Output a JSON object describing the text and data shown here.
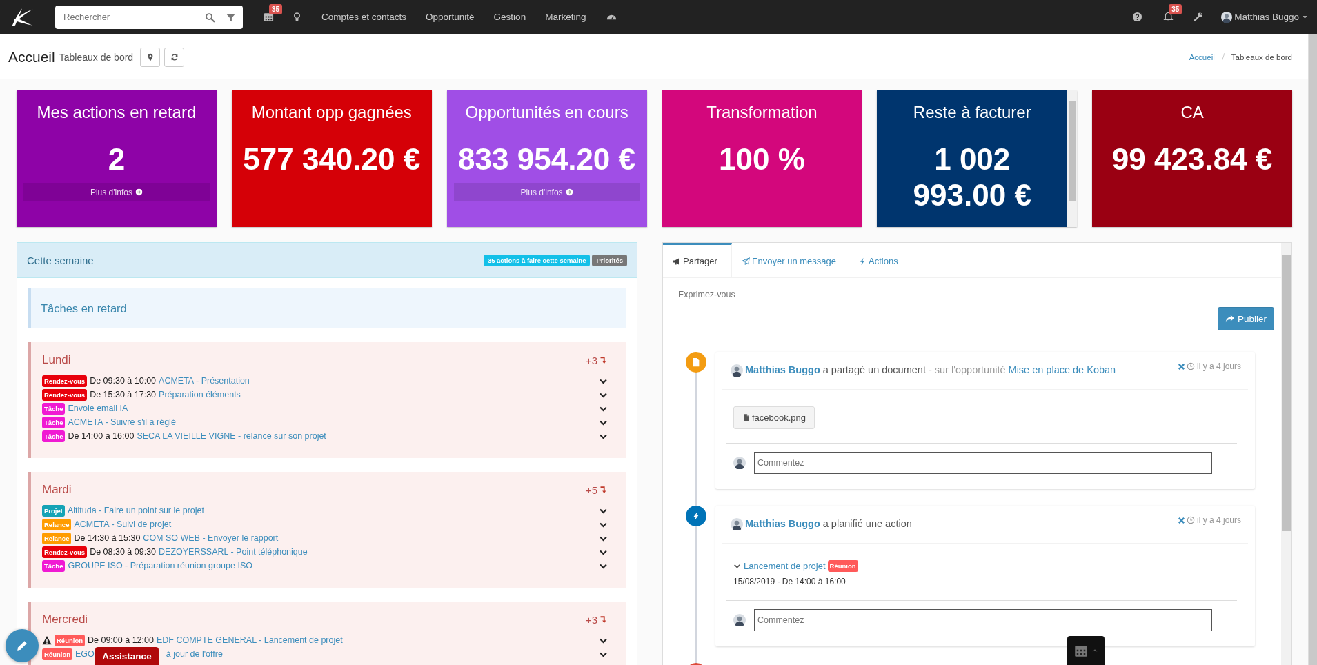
{
  "nav": {
    "search_placeholder": "Rechercher",
    "calendar_badge": "35",
    "menu": [
      "Comptes et contacts",
      "Opportunité",
      "Gestion",
      "Marketing"
    ],
    "notifications_badge": "35",
    "user": "Matthias Buggo"
  },
  "header": {
    "title": "Accueil",
    "subtitle": "Tableaux de bord",
    "breadcrumb": [
      {
        "label": "Accueil",
        "current": false
      },
      {
        "label": "Tableaux de bord",
        "current": true
      }
    ]
  },
  "cards": [
    {
      "title": "Mes actions en retard",
      "value": "2",
      "more": "Plus d'infos",
      "color": "#8e03a7"
    },
    {
      "title": "Montant opp gagnées",
      "value": "577 340.20 €",
      "color": "#d50007"
    },
    {
      "title": "Opportunités en cours",
      "value": "833 954.20 €",
      "more": "Plus d'infos",
      "color": "#a04ee6"
    },
    {
      "title": "Transformation",
      "value": "100 %",
      "color": "#d3077c"
    },
    {
      "title": "Reste à facturer",
      "value": "1 002 993.00 €",
      "color": "#00356e"
    },
    {
      "title": "CA",
      "value": "99 423.84 €",
      "color": "#9a0012"
    }
  ],
  "week": {
    "title": "Cette semaine",
    "badges": [
      {
        "label": "35 actions à faire cette semaine",
        "kind": "info"
      },
      {
        "label": "Priorités",
        "kind": "default"
      }
    ],
    "overdue": "Tâches en retard",
    "days": [
      {
        "name": "Lundi",
        "more": "+3",
        "items": [
          {
            "warning": false,
            "tag": {
              "label": "Rendez-vous",
              "color": "#e8000b"
            },
            "time": "De 09:30 à 10:00",
            "link": "ACMETA - Présentation"
          },
          {
            "warning": false,
            "tag": {
              "label": "Rendez-vous",
              "color": "#e8000b"
            },
            "time": "De 15:30 à 17:30",
            "link": "Préparation éléments"
          },
          {
            "warning": false,
            "tag": {
              "label": "Tâche",
              "color": "#f01ad3"
            },
            "link": "Envoie email IA"
          },
          {
            "warning": false,
            "tag": {
              "label": "Tâche",
              "color": "#f01ad3"
            },
            "link": "ACMETA - Suivre s'il a réglé"
          },
          {
            "warning": false,
            "tag": {
              "label": "Tâche",
              "color": "#f01ad3"
            },
            "time": "De 14:00 à 16:00",
            "link": "SECA LA VIEILLE VIGNE - relance sur son projet"
          }
        ]
      },
      {
        "name": "Mardi",
        "more": "+5",
        "items": [
          {
            "warning": false,
            "tag": {
              "label": "Projet",
              "color": "#16a3b6"
            },
            "link": "Altituda - Faire un point sur le projet"
          },
          {
            "warning": false,
            "tag": {
              "label": "Relance",
              "color": "#ff9c00"
            },
            "link": "ACMETA - Suivi de projet"
          },
          {
            "warning": false,
            "tag": {
              "label": "Relance",
              "color": "#ff9c00"
            },
            "time": "De 14:30 à 15:30",
            "link": "COM SO WEB - Envoyer le rapport"
          },
          {
            "warning": false,
            "tag": {
              "label": "Rendez-vous",
              "color": "#e8000b"
            },
            "time": "De 08:30 à 09:30",
            "link": "DEZOYERSSARL - Point téléphonique"
          },
          {
            "warning": false,
            "tag": {
              "label": "Tâche",
              "color": "#f01ad3"
            },
            "link": "GROUPE ISO - Préparation réunion groupe ISO"
          }
        ]
      },
      {
        "name": "Mercredi",
        "more": "+3",
        "items": [
          {
            "warning": true,
            "tag": {
              "label": "Réunion",
              "color": "#ff5a5a"
            },
            "time": "De 09:00 à 12:00",
            "link": "EDF COMPTE GENERAL - Lancement de projet"
          },
          {
            "warning": false,
            "tag": {
              "label": "Réunion",
              "color": "#ff5a5a"
            },
            "link": "EGO",
            "link_tail": "à jour de l'offre"
          }
        ]
      }
    ]
  },
  "feed": {
    "tabs": [
      {
        "label": "Partager",
        "selected": true
      },
      {
        "label": "Envoyer un message",
        "selected": false
      },
      {
        "label": "Actions",
        "selected": false
      }
    ],
    "composer_placeholder": "Exprimez-vous",
    "publish": "Publier",
    "posts": [
      {
        "kind": "document",
        "author": "Matthias Buggo",
        "verb": "a partagé un document",
        "context": "- sur l'opportunité",
        "context_link": "Mise en place de Koban",
        "time": "il y a 4 jours",
        "attachment": "facebook.png",
        "comment_placeholder": "Commentez"
      },
      {
        "kind": "action",
        "author": "Matthias Buggo",
        "verb": "a planifié une action",
        "time": "il y a 4 jours",
        "action": {
          "title": "Lancement de projet",
          "tag": {
            "label": "Réunion",
            "color": "#ff5a5a"
          },
          "date": "15/08/2019 - De 14:00 à 16:00"
        },
        "comment_placeholder": "Commentez"
      },
      {
        "kind": "event"
      }
    ]
  },
  "assistance": "Assistance"
}
